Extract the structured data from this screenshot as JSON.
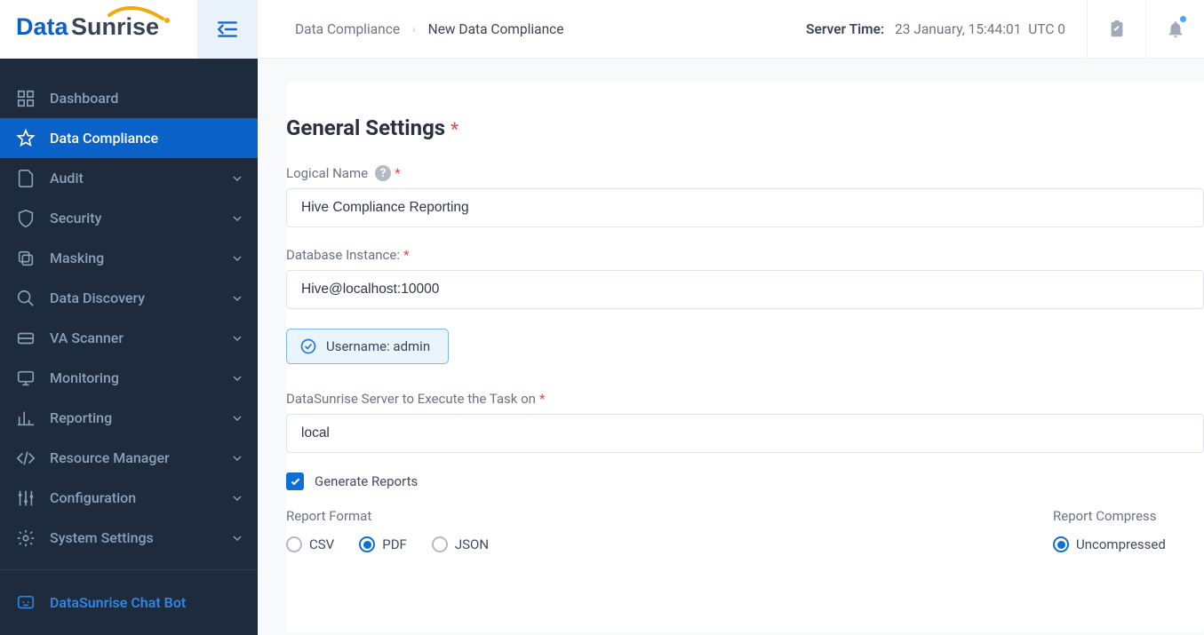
{
  "logo": {
    "part1": "Data",
    "part2": "Sunrise"
  },
  "breadcrumb": {
    "parent": "Data Compliance",
    "current": "New Data Compliance"
  },
  "server_time": {
    "label": "Server Time:",
    "value": "23 January, 15:44:01",
    "utc": "UTC 0"
  },
  "sidebar": {
    "items": [
      {
        "label": "Dashboard",
        "expandable": false
      },
      {
        "label": "Data Compliance",
        "expandable": false,
        "active": true
      },
      {
        "label": "Audit",
        "expandable": true
      },
      {
        "label": "Security",
        "expandable": true
      },
      {
        "label": "Masking",
        "expandable": true
      },
      {
        "label": "Data Discovery",
        "expandable": true
      },
      {
        "label": "VA Scanner",
        "expandable": true
      },
      {
        "label": "Monitoring",
        "expandable": true
      },
      {
        "label": "Reporting",
        "expandable": true
      },
      {
        "label": "Resource Manager",
        "expandable": true
      },
      {
        "label": "Configuration",
        "expandable": true
      },
      {
        "label": "System Settings",
        "expandable": true
      }
    ],
    "chatbot": "DataSunrise Chat Bot"
  },
  "form": {
    "section_title": "General Settings",
    "logical_name_label": "Logical Name",
    "logical_name_value": "Hive Compliance Reporting",
    "db_instance_label": "Database Instance:",
    "db_instance_value": "Hive@localhost:10000",
    "username_chip": "Username: admin",
    "server_exec_label": "DataSunrise Server to Execute the Task on",
    "server_exec_value": "local",
    "generate_reports": "Generate Reports",
    "report_format_label": "Report Format",
    "formats": {
      "csv": "CSV",
      "pdf": "PDF",
      "json": "JSON"
    },
    "report_compress_label": "Report Compress",
    "compress": {
      "uncompressed": "Uncompressed"
    }
  }
}
